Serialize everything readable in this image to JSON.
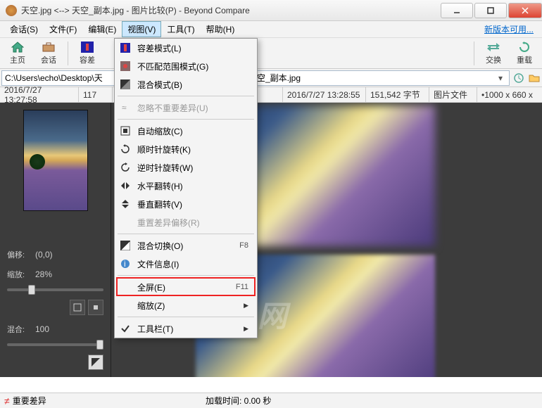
{
  "window": {
    "title": "天空.jpg <--> 天空_副本.jpg - 图片比较(P) - Beyond Compare"
  },
  "menubar": {
    "items": [
      "会话(S)",
      "文件(F)",
      "编辑(E)",
      "视图(V)",
      "工具(T)",
      "帮助(H)"
    ],
    "active_index": 3,
    "new_version": "新版本可用..."
  },
  "toolbar": {
    "home": "主页",
    "session": "会话",
    "tolerance": "容差",
    "swap": "交换",
    "reload": "重载"
  },
  "paths": {
    "left": "C:\\Users\\echo\\Desktop\\天",
    "right": "C:\\Users\\echo\\Desktop\\天空_副本.jpg"
  },
  "status": {
    "left_time": "2016/7/27 13:27:58",
    "left_size_partial": "117",
    "right_time": "2016/7/27 13:28:55",
    "right_size": "151,542 字节",
    "file_type": "图片文件",
    "dimensions": "1000 x 660 x"
  },
  "controls": {
    "offset_label": "偏移:",
    "offset_value": "(0,0)",
    "zoom_label": "缩放:",
    "zoom_value": "28%",
    "blend_label": "混合:",
    "blend_value": "100"
  },
  "dropdown": {
    "items": [
      {
        "label": "容差模式(L)",
        "icon": "tolerance"
      },
      {
        "label": "不匹配范围模式(G)",
        "icon": "mismatch"
      },
      {
        "label": "混合模式(B)",
        "icon": "blend"
      },
      {
        "sep": true
      },
      {
        "label": "忽略不重要差异(U)",
        "icon": "approx",
        "disabled": true
      },
      {
        "sep": true
      },
      {
        "label": "自动缩放(C)",
        "icon": "autozoom"
      },
      {
        "label": "顺时针旋转(K)",
        "icon": "rotate-cw"
      },
      {
        "label": "逆时针旋转(W)",
        "icon": "rotate-ccw"
      },
      {
        "label": "水平翻转(H)",
        "icon": "flip-h"
      },
      {
        "label": "垂直翻转(V)",
        "icon": "flip-v"
      },
      {
        "label": "重置差异偏移(R)",
        "disabled": true
      },
      {
        "sep": true
      },
      {
        "label": "混合切换(O)",
        "icon": "blend-toggle",
        "shortcut": "F8"
      },
      {
        "label": "文件信息(I)",
        "icon": "info"
      },
      {
        "sep": true
      },
      {
        "label": "全屏(E)",
        "shortcut": "F11",
        "highlight": true
      },
      {
        "label": "缩放(Z)",
        "submenu": true
      },
      {
        "sep": true
      },
      {
        "label": "工具栏(T)",
        "icon": "check",
        "submenu": true
      }
    ]
  },
  "footer": {
    "diff_label": "重要差异",
    "load_time": "加载时间: 0.00 秒"
  },
  "watermark": "GX / 网"
}
